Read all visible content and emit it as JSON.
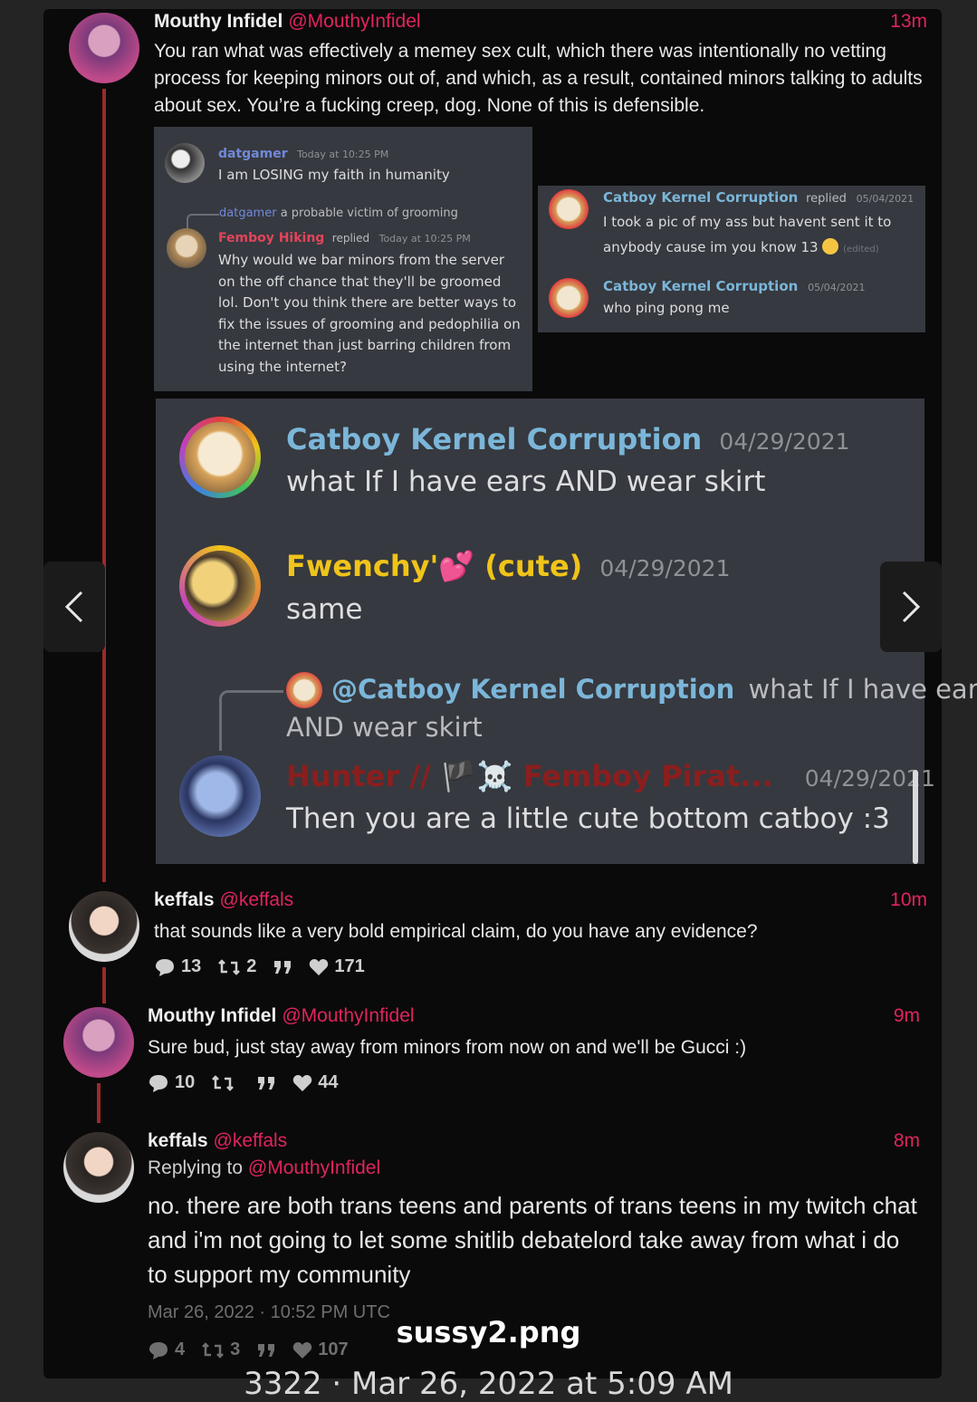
{
  "tweets": [
    {
      "name": "Mouthy Infidel",
      "handle": "@MouthyInfidel",
      "time": "13m",
      "text": "You ran what was effectively a memey sex cult, which there was intentionally no vetting process for keeping minors out of, and which, as a result, contained minors talking to adults about sex. You’re a fucking creep, dog. None of this is defensible."
    },
    {
      "name": "keffals",
      "handle": "@keffals",
      "time": "10m",
      "text": "that sounds like a very bold empirical claim, do you have any evidence?",
      "replies": "13",
      "retweets": "2",
      "likes": "171"
    },
    {
      "name": "Mouthy Infidel",
      "handle": "@MouthyInfidel",
      "time": "9m",
      "text": "Sure bud, just stay away from minors from now on and we'll be Gucci :)",
      "replies": "10",
      "retweets": "",
      "likes": "44"
    },
    {
      "name": "keffals",
      "handle": "@keffals",
      "time": "8m",
      "replying_label": "Replying to",
      "replying_to": "@MouthyInfidel",
      "text": "no. there are both trans teens and parents of trans teens in my twitch chat and i'm not going to let some shitlib debatelord take away from what i do to support my community",
      "timestamp": "Mar 26, 2022 · 10:52 PM UTC",
      "replies": "4",
      "retweets": "3",
      "likes": "107"
    }
  ],
  "discord_a": {
    "top_user": "datgamer",
    "top_date": "Today at 10:25 PM",
    "top_text": "I am LOSING my faith in humanity",
    "reply_ref_user": "datgamer",
    "reply_ref_text": "a probable victim of grooming",
    "user": "Femboy Hiking",
    "replied": "replied",
    "date": "Today at 10:25 PM",
    "text": "Why would we bar minors from the server on the off chance that they'll be groomed lol. Don't you think there are better ways to fix the issues of grooming and pedophilia on the internet than just barring children from using the internet?"
  },
  "discord_b": {
    "user1": "Catboy Kernel Corruption",
    "replied": "replied",
    "date1": "05/04/2021",
    "text1": "I took a pic of my ass but havent sent it to anybody cause im you know 13",
    "edited": "(edited)",
    "user2": "Catboy Kernel Corruption",
    "date2": "05/04/2021",
    "text2": "who ping pong me"
  },
  "discord_c": {
    "msg1_user": "Catboy Kernel Corruption",
    "msg1_date": "04/29/2021",
    "msg1_text": "what If I have ears AND wear skirt",
    "msg2_user": "Fwenchy'💕 (cute)",
    "msg2_date": "04/29/2021",
    "msg2_text": "same",
    "reply_ref_user": "@Catboy Kernel Corruption",
    "reply_ref_text": "what If I have ears",
    "reply_ref_text2": "AND wear skirt",
    "msg3_user": "Hunter // 🏴☠️ Femboy Pirat...",
    "msg3_date": "04/29/2021",
    "msg3_text": "Then you are a little cute bottom catboy :3"
  },
  "caption": {
    "title": "sussy2.png",
    "meta": "3322 · Mar 26, 2022 at 5:09 AM"
  },
  "colors": {
    "accent": "#e0245e",
    "thread": "#9b2a2a",
    "discord_bg": "#36393f",
    "catboy_name": "#7bb6d9",
    "fwenchy_name": "#f0c419",
    "hunter_name": "#8b1e1e",
    "femboy_name": "#e0455a"
  },
  "icons": [
    "reply-icon",
    "retweet-icon",
    "quote-icon",
    "heart-icon",
    "chevron-left-icon",
    "chevron-right-icon"
  ]
}
